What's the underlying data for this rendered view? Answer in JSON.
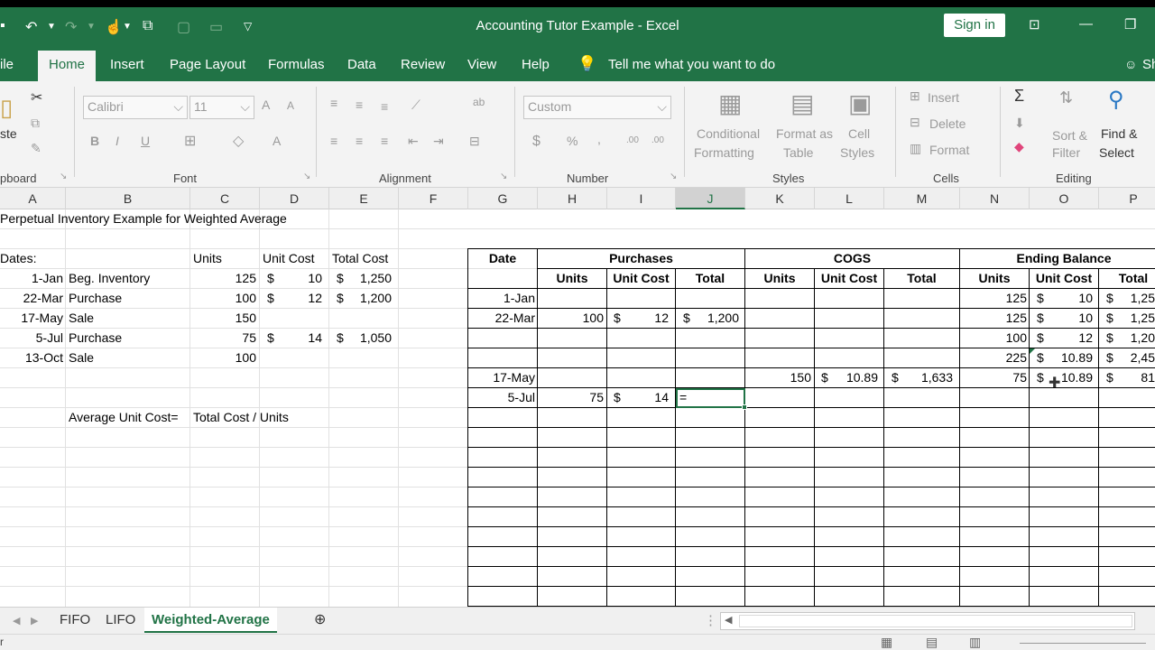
{
  "window": {
    "title": "Accounting Tutor Example  -  Excel",
    "sign_in": "Sign in"
  },
  "ribbon_tabs": [
    "ile",
    "Home",
    "Insert",
    "Page Layout",
    "Formulas",
    "Data",
    "Review",
    "View",
    "Help"
  ],
  "tell_me": "Tell me what you want to do",
  "share_label": "Sh",
  "ribbon": {
    "clipboard": {
      "paste": "ste",
      "label": "pboard"
    },
    "font": {
      "name": "Calibri",
      "size": "11",
      "bold": "B",
      "italic": "I",
      "underline": "U",
      "grow": "A",
      "shrink": "A",
      "color": "A",
      "label": "Font"
    },
    "alignment": {
      "label": "Alignment"
    },
    "number": {
      "format": "Custom",
      "currency": "$",
      "percent": "%",
      "comma": ",",
      "inc": ".00",
      "dec": ".00",
      "label": "Number"
    },
    "styles": {
      "conditional": "Conditional",
      "formatting": "Formatting",
      "format_as": "Format as",
      "table": "Table",
      "cell": "Cell",
      "cell_styles": "Styles",
      "label": "Styles"
    },
    "cells": {
      "insert": "Insert",
      "delete": "Delete",
      "format": "Format",
      "label": "Cells"
    },
    "editing": {
      "sigma": "Σ",
      "sort": "Sort &",
      "filter": "Filter",
      "find": "Find &",
      "select": "Select",
      "label": "Editing"
    }
  },
  "columns": [
    "A",
    "B",
    "C",
    "D",
    "E",
    "F",
    "G",
    "H",
    "I",
    "J",
    "K",
    "L",
    "M",
    "N",
    "O",
    "P"
  ],
  "selected_column": "J",
  "sheet": {
    "title": "Perpetual Inventory Example for Weighted Average",
    "left_headers": {
      "dates": "Dates:",
      "units": "Units",
      "unit_cost": "Unit Cost",
      "total_cost": "Total Cost"
    },
    "left_rows": [
      {
        "date": "1-Jan",
        "desc": "Beg. Inventory",
        "units": "125",
        "cost_sym": "$",
        "cost": "10",
        "total_sym": "$",
        "total": "1,250"
      },
      {
        "date": "22-Mar",
        "desc": "Purchase",
        "units": "100",
        "cost_sym": "$",
        "cost": "12",
        "total_sym": "$",
        "total": "1,200"
      },
      {
        "date": "17-May",
        "desc": "Sale",
        "units": "150",
        "cost_sym": "",
        "cost": "",
        "total_sym": "",
        "total": ""
      },
      {
        "date": "5-Jul",
        "desc": "Purchase",
        "units": "75",
        "cost_sym": "$",
        "cost": "14",
        "total_sym": "$",
        "total": "1,050"
      },
      {
        "date": "13-Oct",
        "desc": "Sale",
        "units": "100",
        "cost_sym": "",
        "cost": "",
        "total_sym": "",
        "total": ""
      }
    ],
    "avg_label": "Average Unit Cost=",
    "avg_formula": "Total Cost / Units",
    "table": {
      "date": "Date",
      "purchases": "Purchases",
      "cogs": "COGS",
      "ending": "Ending Balance",
      "sub": [
        "Units",
        "Unit Cost",
        "Total",
        "Units",
        "Unit Cost",
        "Total",
        "Units",
        "Unit Cost",
        "Total"
      ],
      "rows": [
        {
          "date": "1-Jan",
          "pu": "",
          "pc": "",
          "pt": "",
          "cu": "",
          "cc": "",
          "ct": "",
          "eu": "125",
          "ec": "10",
          "et": "1,25"
        },
        {
          "date": "22-Mar",
          "pu": "100",
          "pc": "12",
          "pt": "1,200",
          "cu": "",
          "cc": "",
          "ct": "",
          "eu": "125",
          "ec": "10",
          "et": "1,25"
        },
        {
          "date": "",
          "pu": "",
          "pc": "",
          "pt": "",
          "cu": "",
          "cc": "",
          "ct": "",
          "eu": "100",
          "ec": "12",
          "et": "1,20"
        },
        {
          "date": "",
          "pu": "",
          "pc": "",
          "pt": "",
          "cu": "",
          "cc": "",
          "ct": "",
          "eu": "225",
          "ec": "10.89",
          "et": "2,45"
        },
        {
          "date": "17-May",
          "pu": "",
          "pc": "",
          "pt": "",
          "cu": "150",
          "cc": "10.89",
          "ct": "1,633",
          "eu": "75",
          "ec": "10.89",
          "et": "81"
        },
        {
          "date": "5-Jul",
          "pu": "75",
          "pc": "14",
          "pt": "=",
          "cu": "",
          "cc": "",
          "ct": "",
          "eu": "",
          "ec": "",
          "et": ""
        }
      ]
    }
  },
  "sheet_tabs": [
    "FIFO",
    "LIFO",
    "Weighted-Average"
  ],
  "active_sheet": "Weighted-Average",
  "status_text": "r",
  "accent": "#217346"
}
